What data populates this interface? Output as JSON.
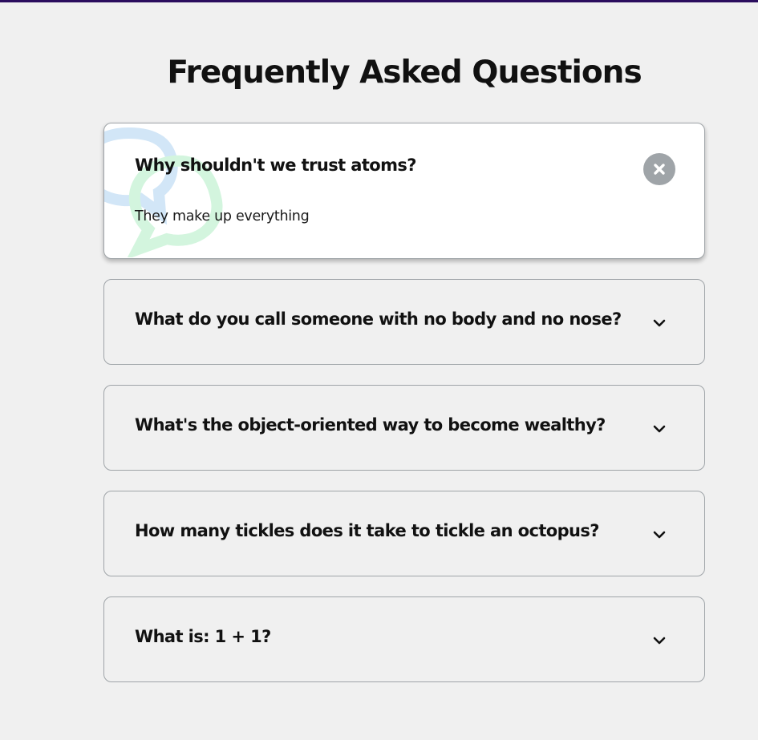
{
  "page": {
    "title": "Frequently Asked Questions"
  },
  "colors": {
    "accent_top_bar": "#2b0d5e",
    "background": "#f0f0f0",
    "card_active_bg": "#ffffff",
    "border": "#9fa4a8",
    "bubble_blue": "#d2e6f7",
    "bubble_green": "#d3f5de",
    "close_button_bg": "#9fa4a8"
  },
  "faqs": [
    {
      "question": "Why shouldn't we trust atoms?",
      "answer": "They make up everything",
      "state": "open",
      "toggle_icon": "close-icon"
    },
    {
      "question": "What do you call someone with no body and no nose?",
      "state": "closed",
      "toggle_icon": "chevron-down-icon"
    },
    {
      "question": "What's the object-oriented way to become wealthy?",
      "state": "closed",
      "toggle_icon": "chevron-down-icon"
    },
    {
      "question": "How many tickles does it take to tickle an octopus?",
      "state": "closed",
      "toggle_icon": "chevron-down-icon"
    },
    {
      "question": "What is: 1 + 1?",
      "state": "closed",
      "toggle_icon": "chevron-down-icon"
    }
  ]
}
